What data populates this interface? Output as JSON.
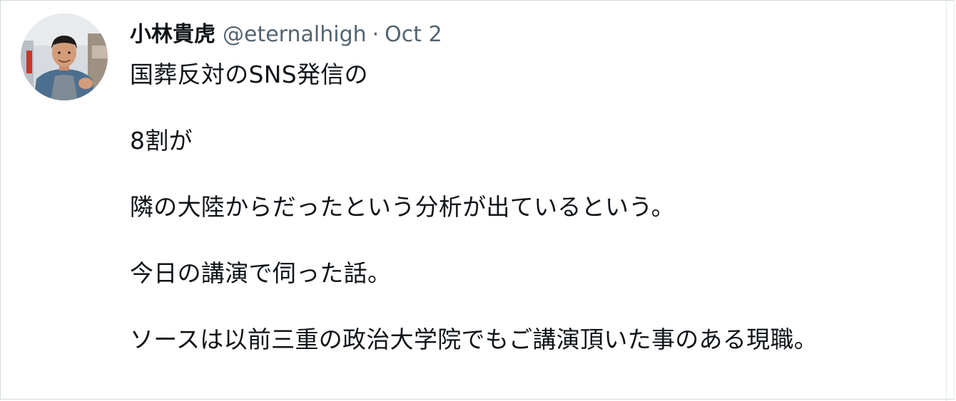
{
  "tweet": {
    "author": {
      "display_name": "小林貴虎",
      "handle": "@eternalhigh"
    },
    "separator": "·",
    "timestamp": "Oct 2",
    "lines": [
      "国葬反対のSNS発信の",
      "8割が",
      "隣の大陸からだったという分析が出ているという。",
      "今日の講演で伺った話。",
      "ソースは以前三重の政治大学院でもご講演頂いた事のある現職。"
    ]
  },
  "colors": {
    "text_primary": "#0f1419",
    "text_secondary": "#536471",
    "border": "#cfd9de"
  }
}
